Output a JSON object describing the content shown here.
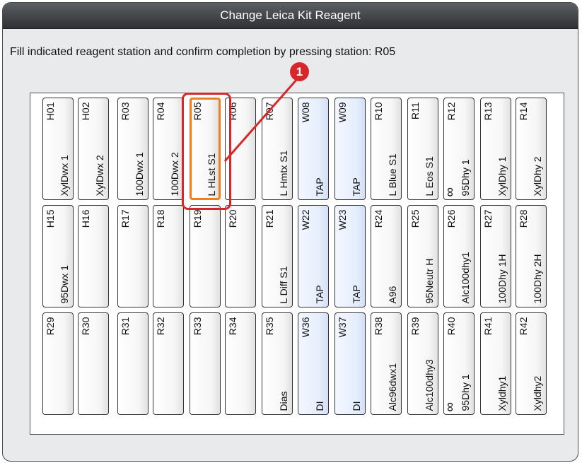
{
  "window": {
    "title": "Change Leica Kit Reagent"
  },
  "instruction": "Fill indicated reagent station and confirm completion by pressing station: R05",
  "callout": {
    "number": "1",
    "color": "#d8262b"
  },
  "colors": {
    "highlight": "#d8262b",
    "target_station_border": "#f07d1e",
    "water_station_fill": "#e6eefc"
  },
  "stations": [
    {
      "id": "H01",
      "reagent": "XylDwx 1",
      "type": "normal"
    },
    {
      "id": "H02",
      "reagent": "XylDwx 2",
      "type": "normal"
    },
    {
      "id": "R03",
      "reagent": "100Dwx 1",
      "type": "normal"
    },
    {
      "id": "R04",
      "reagent": "100Dwx 2",
      "type": "normal"
    },
    {
      "id": "R05",
      "reagent": "L HLst S1",
      "type": "target"
    },
    {
      "id": "R06",
      "reagent": "",
      "type": "normal"
    },
    {
      "id": "R07",
      "reagent": "L Hmtx S1",
      "type": "normal"
    },
    {
      "id": "W08",
      "reagent": "TAP",
      "type": "water"
    },
    {
      "id": "W09",
      "reagent": "TAP",
      "type": "water"
    },
    {
      "id": "R10",
      "reagent": "L Blue S1",
      "type": "normal"
    },
    {
      "id": "R11",
      "reagent": "L Eos S1",
      "type": "normal"
    },
    {
      "id": "R12",
      "reagent": "95Dhy 1",
      "type": "infinity"
    },
    {
      "id": "R13",
      "reagent": "XylDhy 1",
      "type": "normal"
    },
    {
      "id": "R14",
      "reagent": "XylDhy 2",
      "type": "normal"
    },
    {
      "id": "H15",
      "reagent": "95Dwx 1",
      "type": "normal"
    },
    {
      "id": "H16",
      "reagent": "",
      "type": "normal"
    },
    {
      "id": "R17",
      "reagent": "",
      "type": "normal"
    },
    {
      "id": "R18",
      "reagent": "",
      "type": "normal"
    },
    {
      "id": "R19",
      "reagent": "",
      "type": "normal"
    },
    {
      "id": "R20",
      "reagent": "",
      "type": "normal"
    },
    {
      "id": "R21",
      "reagent": "L Diff S1",
      "type": "normal"
    },
    {
      "id": "W22",
      "reagent": "TAP",
      "type": "water"
    },
    {
      "id": "W23",
      "reagent": "TAP",
      "type": "water"
    },
    {
      "id": "R24",
      "reagent": "A96",
      "type": "normal"
    },
    {
      "id": "R25",
      "reagent": "95Neutr H",
      "type": "normal"
    },
    {
      "id": "R26",
      "reagent": "Alc100dhy1",
      "type": "normal"
    },
    {
      "id": "R27",
      "reagent": "100Dhy 1H",
      "type": "normal"
    },
    {
      "id": "R28",
      "reagent": "100Dhy 2H",
      "type": "normal"
    },
    {
      "id": "R29",
      "reagent": "",
      "type": "normal"
    },
    {
      "id": "R30",
      "reagent": "",
      "type": "normal"
    },
    {
      "id": "R31",
      "reagent": "",
      "type": "normal"
    },
    {
      "id": "R32",
      "reagent": "",
      "type": "normal"
    },
    {
      "id": "R33",
      "reagent": "",
      "type": "normal"
    },
    {
      "id": "R34",
      "reagent": "",
      "type": "normal"
    },
    {
      "id": "R35",
      "reagent": "Dias",
      "type": "normal"
    },
    {
      "id": "W36",
      "reagent": "DI",
      "type": "water"
    },
    {
      "id": "W37",
      "reagent": "DI",
      "type": "water"
    },
    {
      "id": "R38",
      "reagent": "Alc96dwx1",
      "type": "normal"
    },
    {
      "id": "R39",
      "reagent": "Alc100dhy3",
      "type": "normal"
    },
    {
      "id": "R40",
      "reagent": "95Dhy 1",
      "type": "infinity"
    },
    {
      "id": "R41",
      "reagent": "Xyldhy1",
      "type": "normal"
    },
    {
      "id": "R42",
      "reagent": "Xyldhy2",
      "type": "normal"
    }
  ]
}
